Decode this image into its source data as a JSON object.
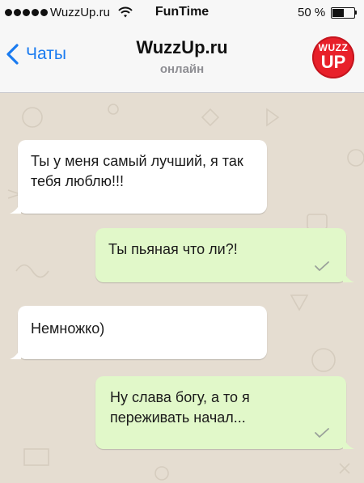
{
  "status_bar": {
    "carrier": "WuzzUp.ru",
    "time": "FunTime",
    "battery_percent": "50 %",
    "battery_level": 0.5
  },
  "nav": {
    "back_label": "Чаты",
    "title": "WuzzUp.ru",
    "subtitle": "онлайн",
    "logo_top": "WUZZ",
    "logo_bottom": "UP"
  },
  "messages": [
    {
      "direction": "incoming",
      "text": "Ты у меня самый лучший, я так тебя люблю!!!"
    },
    {
      "direction": "outgoing",
      "text": "Ты пьяная что ли?!",
      "status": "sent-check"
    },
    {
      "direction": "incoming",
      "text": "Немножко)"
    },
    {
      "direction": "outgoing",
      "text": "Ну слава богу, а то я переживать начал...",
      "status": "sent-check"
    }
  ],
  "colors": {
    "accent": "#1a7bf0",
    "incoming_bubble": "#ffffff",
    "outgoing_bubble": "#e1f8c9",
    "chat_background": "#e5ddd1",
    "logo": "#e8202a"
  }
}
